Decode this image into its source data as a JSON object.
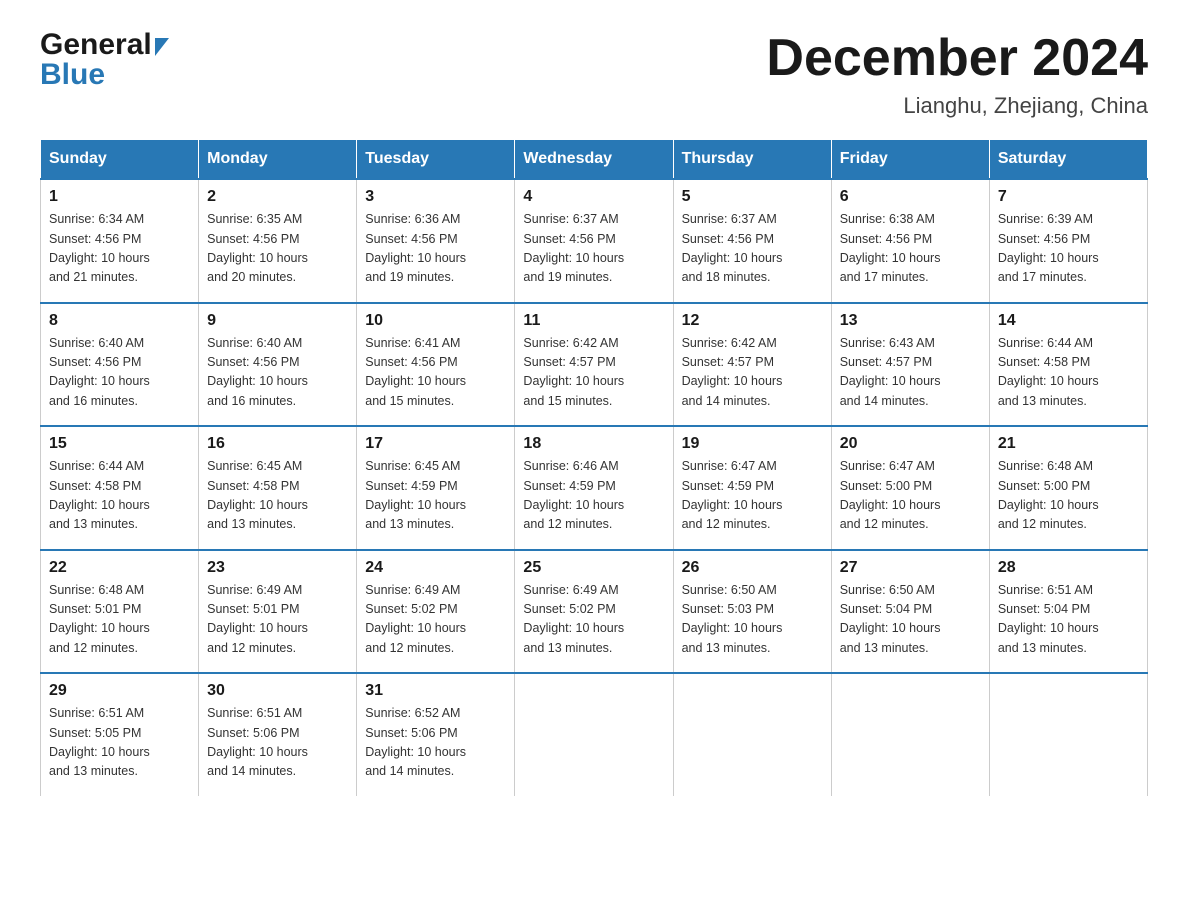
{
  "header": {
    "logo_general": "General",
    "logo_blue": "Blue",
    "month_title": "December 2024",
    "location": "Lianghu, Zhejiang, China"
  },
  "days_of_week": [
    "Sunday",
    "Monday",
    "Tuesday",
    "Wednesday",
    "Thursday",
    "Friday",
    "Saturday"
  ],
  "weeks": [
    [
      {
        "day": "1",
        "sunrise": "6:34 AM",
        "sunset": "4:56 PM",
        "daylight": "10 hours and 21 minutes."
      },
      {
        "day": "2",
        "sunrise": "6:35 AM",
        "sunset": "4:56 PM",
        "daylight": "10 hours and 20 minutes."
      },
      {
        "day": "3",
        "sunrise": "6:36 AM",
        "sunset": "4:56 PM",
        "daylight": "10 hours and 19 minutes."
      },
      {
        "day": "4",
        "sunrise": "6:37 AM",
        "sunset": "4:56 PM",
        "daylight": "10 hours and 19 minutes."
      },
      {
        "day": "5",
        "sunrise": "6:37 AM",
        "sunset": "4:56 PM",
        "daylight": "10 hours and 18 minutes."
      },
      {
        "day": "6",
        "sunrise": "6:38 AM",
        "sunset": "4:56 PM",
        "daylight": "10 hours and 17 minutes."
      },
      {
        "day": "7",
        "sunrise": "6:39 AM",
        "sunset": "4:56 PM",
        "daylight": "10 hours and 17 minutes."
      }
    ],
    [
      {
        "day": "8",
        "sunrise": "6:40 AM",
        "sunset": "4:56 PM",
        "daylight": "10 hours and 16 minutes."
      },
      {
        "day": "9",
        "sunrise": "6:40 AM",
        "sunset": "4:56 PM",
        "daylight": "10 hours and 16 minutes."
      },
      {
        "day": "10",
        "sunrise": "6:41 AM",
        "sunset": "4:56 PM",
        "daylight": "10 hours and 15 minutes."
      },
      {
        "day": "11",
        "sunrise": "6:42 AM",
        "sunset": "4:57 PM",
        "daylight": "10 hours and 15 minutes."
      },
      {
        "day": "12",
        "sunrise": "6:42 AM",
        "sunset": "4:57 PM",
        "daylight": "10 hours and 14 minutes."
      },
      {
        "day": "13",
        "sunrise": "6:43 AM",
        "sunset": "4:57 PM",
        "daylight": "10 hours and 14 minutes."
      },
      {
        "day": "14",
        "sunrise": "6:44 AM",
        "sunset": "4:58 PM",
        "daylight": "10 hours and 13 minutes."
      }
    ],
    [
      {
        "day": "15",
        "sunrise": "6:44 AM",
        "sunset": "4:58 PM",
        "daylight": "10 hours and 13 minutes."
      },
      {
        "day": "16",
        "sunrise": "6:45 AM",
        "sunset": "4:58 PM",
        "daylight": "10 hours and 13 minutes."
      },
      {
        "day": "17",
        "sunrise": "6:45 AM",
        "sunset": "4:59 PM",
        "daylight": "10 hours and 13 minutes."
      },
      {
        "day": "18",
        "sunrise": "6:46 AM",
        "sunset": "4:59 PM",
        "daylight": "10 hours and 12 minutes."
      },
      {
        "day": "19",
        "sunrise": "6:47 AM",
        "sunset": "4:59 PM",
        "daylight": "10 hours and 12 minutes."
      },
      {
        "day": "20",
        "sunrise": "6:47 AM",
        "sunset": "5:00 PM",
        "daylight": "10 hours and 12 minutes."
      },
      {
        "day": "21",
        "sunrise": "6:48 AM",
        "sunset": "5:00 PM",
        "daylight": "10 hours and 12 minutes."
      }
    ],
    [
      {
        "day": "22",
        "sunrise": "6:48 AM",
        "sunset": "5:01 PM",
        "daylight": "10 hours and 12 minutes."
      },
      {
        "day": "23",
        "sunrise": "6:49 AM",
        "sunset": "5:01 PM",
        "daylight": "10 hours and 12 minutes."
      },
      {
        "day": "24",
        "sunrise": "6:49 AM",
        "sunset": "5:02 PM",
        "daylight": "10 hours and 12 minutes."
      },
      {
        "day": "25",
        "sunrise": "6:49 AM",
        "sunset": "5:02 PM",
        "daylight": "10 hours and 13 minutes."
      },
      {
        "day": "26",
        "sunrise": "6:50 AM",
        "sunset": "5:03 PM",
        "daylight": "10 hours and 13 minutes."
      },
      {
        "day": "27",
        "sunrise": "6:50 AM",
        "sunset": "5:04 PM",
        "daylight": "10 hours and 13 minutes."
      },
      {
        "day": "28",
        "sunrise": "6:51 AM",
        "sunset": "5:04 PM",
        "daylight": "10 hours and 13 minutes."
      }
    ],
    [
      {
        "day": "29",
        "sunrise": "6:51 AM",
        "sunset": "5:05 PM",
        "daylight": "10 hours and 13 minutes."
      },
      {
        "day": "30",
        "sunrise": "6:51 AM",
        "sunset": "5:06 PM",
        "daylight": "10 hours and 14 minutes."
      },
      {
        "day": "31",
        "sunrise": "6:52 AM",
        "sunset": "5:06 PM",
        "daylight": "10 hours and 14 minutes."
      },
      null,
      null,
      null,
      null
    ]
  ],
  "labels": {
    "sunrise": "Sunrise:",
    "sunset": "Sunset:",
    "daylight": "Daylight:"
  }
}
